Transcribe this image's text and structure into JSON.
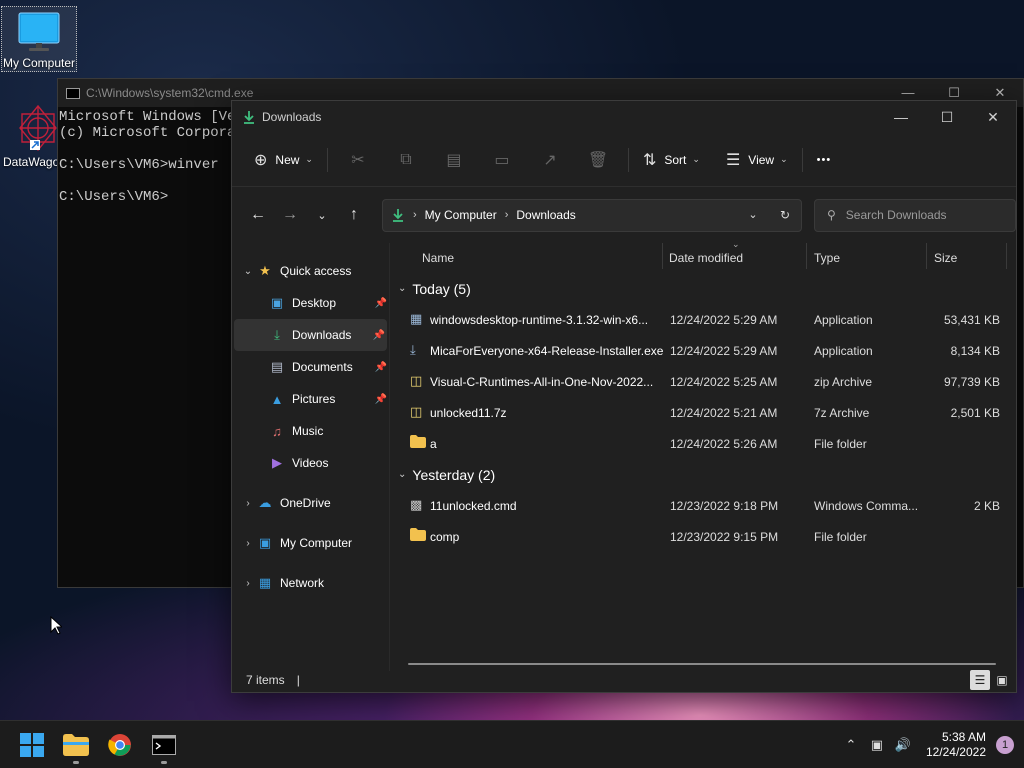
{
  "desktop": {
    "icons": [
      {
        "label": "My Computer"
      },
      {
        "label": "DataWago"
      }
    ]
  },
  "cmd": {
    "title": "C:\\Windows\\system32\\cmd.exe",
    "lines": [
      "Microsoft Windows [Ver",
      "(c) Microsoft Corporat",
      "C:\\Users\\VM6>winver",
      "",
      "C:\\Users\\VM6>"
    ]
  },
  "explorer": {
    "title": "Downloads",
    "toolbar": {
      "new_label": "New",
      "sort_label": "Sort",
      "view_label": "View",
      "more_label": "•••"
    },
    "breadcrumb": [
      "My Computer",
      "Downloads"
    ],
    "search_placeholder": "Search Downloads",
    "nav": {
      "quick_access": "Quick access",
      "items": [
        {
          "label": "Desktop",
          "icon": "desktop-icon",
          "pinned": true
        },
        {
          "label": "Downloads",
          "icon": "download-icon",
          "pinned": true,
          "selected": true
        },
        {
          "label": "Documents",
          "icon": "documents-icon",
          "pinned": true
        },
        {
          "label": "Pictures",
          "icon": "pictures-icon",
          "pinned": true
        },
        {
          "label": "Music",
          "icon": "music-icon",
          "pinned": false
        },
        {
          "label": "Videos",
          "icon": "videos-icon",
          "pinned": false
        }
      ],
      "onedrive": "OneDrive",
      "my_computer": "My Computer",
      "network": "Network"
    },
    "columns": {
      "name": "Name",
      "date": "Date modified",
      "type": "Type",
      "size": "Size"
    },
    "groups": [
      {
        "label": "Today (5)",
        "files": [
          {
            "name": "windowsdesktop-runtime-3.1.32-win-x6...",
            "date": "12/24/2022 5:29 AM",
            "type": "Application",
            "size": "53,431 KB",
            "icon": "installer-icon"
          },
          {
            "name": "MicaForEveryone-x64-Release-Installer.exe",
            "date": "12/24/2022 5:29 AM",
            "type": "Application",
            "size": "8,134 KB",
            "icon": "installer-icon"
          },
          {
            "name": "Visual-C-Runtimes-All-in-One-Nov-2022...",
            "date": "12/24/2022 5:25 AM",
            "type": "zip Archive",
            "size": "97,739 KB",
            "icon": "archive-icon"
          },
          {
            "name": "unlocked11.7z",
            "date": "12/24/2022 5:21 AM",
            "type": "7z Archive",
            "size": "2,501 KB",
            "icon": "archive-icon"
          },
          {
            "name": "a",
            "date": "12/24/2022 5:26 AM",
            "type": "File folder",
            "size": "",
            "icon": "folder-icon"
          }
        ]
      },
      {
        "label": "Yesterday (2)",
        "files": [
          {
            "name": "11unlocked.cmd",
            "date": "12/23/2022 9:18 PM",
            "type": "Windows Comma...",
            "size": "2 KB",
            "icon": "script-icon"
          },
          {
            "name": "comp",
            "date": "12/23/2022 9:15 PM",
            "type": "File folder",
            "size": "",
            "icon": "folder-icon"
          }
        ]
      }
    ],
    "status": "7 items"
  },
  "taskbar": {
    "time": "5:38 AM",
    "date": "12/24/2022",
    "notifications": "1"
  },
  "colors": {
    "accent_green": "#3fbf7f",
    "folder_yellow": "#f2c14e",
    "explorer_bg": "#202020"
  }
}
